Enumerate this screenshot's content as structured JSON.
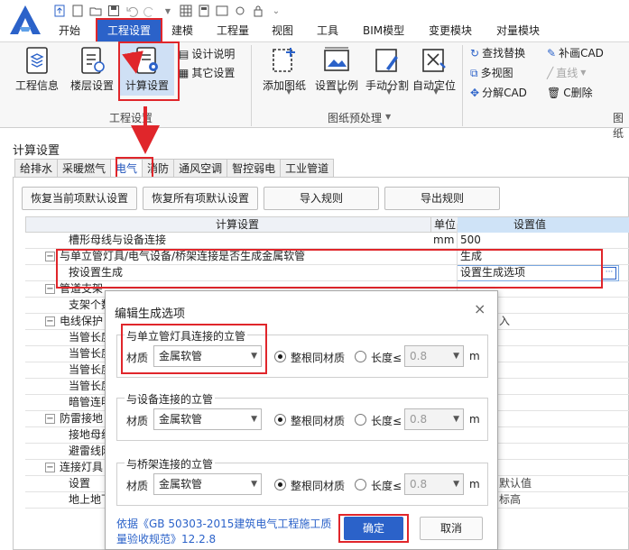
{
  "menu": {
    "tabs": [
      "开始",
      "工程设置",
      "建模",
      "工程量",
      "视图",
      "工具",
      "BIM模型",
      "变更模块",
      "对量模块"
    ],
    "active": "工程设置"
  },
  "ribbon": {
    "group1": {
      "buttons": [
        "工程信息",
        "楼层设置",
        "计算设置"
      ],
      "small": [
        "设计说明",
        "其它设置"
      ],
      "label": "工程设置"
    },
    "group2": {
      "buttons": [
        "添加图纸",
        "设置比例",
        "手动分割",
        "自动定位"
      ],
      "label": "图纸预处理"
    },
    "group3": {
      "items": [
        "查找替换",
        "补画CAD",
        "多视图",
        "直线",
        "分解CAD",
        "C删除"
      ],
      "label_partial": "图纸"
    }
  },
  "panel": {
    "title": "计算设置",
    "subtabs": [
      "给排水",
      "采暖燃气",
      "电气",
      "消防",
      "通风空调",
      "智控弱电",
      "工业管道"
    ],
    "active_subtab": "电气",
    "actions": [
      "恢复当前项默认设置",
      "恢复所有项默认设置",
      "导入规则",
      "导出规则"
    ]
  },
  "grid": {
    "headers": [
      "计算设置",
      "单位",
      "设置值"
    ],
    "rows": [
      {
        "name": "槽形母线与设备连接",
        "unit": "mm",
        "value": "500"
      },
      {
        "name": "与单立管灯具/电气设备/桥架连接是否生成金属软管",
        "unit": "",
        "value": "生成",
        "toggle": "−"
      },
      {
        "name": "按设置生成",
        "unit": "",
        "value": "设置生成选项"
      },
      {
        "name": "管道支架",
        "toggle": "−"
      },
      {
        "name": "支架个数"
      },
      {
        "name": "电线保护",
        "toggle": "−"
      },
      {
        "name": "当管长度"
      },
      {
        "name": "当管长度"
      },
      {
        "name": "当管长度"
      },
      {
        "name": "当管长度"
      },
      {
        "name": "暗管连明数"
      },
      {
        "name": "防雷接地",
        "toggle": "−"
      },
      {
        "name": "接地母线"
      },
      {
        "name": "避雷线网"
      },
      {
        "name": "连接灯具",
        "toggle": "−"
      },
      {
        "name": "设置"
      },
      {
        "name": "地上地下工程"
      }
    ],
    "right_fragments": {
      "row5": "入",
      "row15": "默认值",
      "row16": "标高"
    }
  },
  "dialog": {
    "title": "编辑生成选项",
    "close": "×",
    "groups": [
      {
        "legend": "与单立管灯具连接的立管",
        "material_label": "材质",
        "material": "金属软管",
        "option_whole": "整根同材质",
        "option_length": "长度≤",
        "length": "0.8",
        "unit": "m",
        "selected": "whole"
      },
      {
        "legend": "与设备连接的立管",
        "material_label": "材质",
        "material": "金属软管",
        "option_whole": "整根同材质",
        "option_length": "长度≤",
        "length": "0.8",
        "unit": "m",
        "selected": "whole"
      },
      {
        "legend": "与桥架连接的立管",
        "material_label": "材质",
        "material": "金属软管",
        "option_whole": "整根同材质",
        "option_length": "长度≤",
        "length": "0.8",
        "unit": "m",
        "selected": "whole"
      }
    ],
    "note_line1": "依据《GB 50303-2015建筑电气工程施工质",
    "note_line2": "量验收规范》12.2.8",
    "ok": "确定",
    "cancel": "取消"
  },
  "colors": {
    "accent": "#2b62c9",
    "annotation": "#e0262b",
    "header_value_bg": "#cfe3f7"
  }
}
